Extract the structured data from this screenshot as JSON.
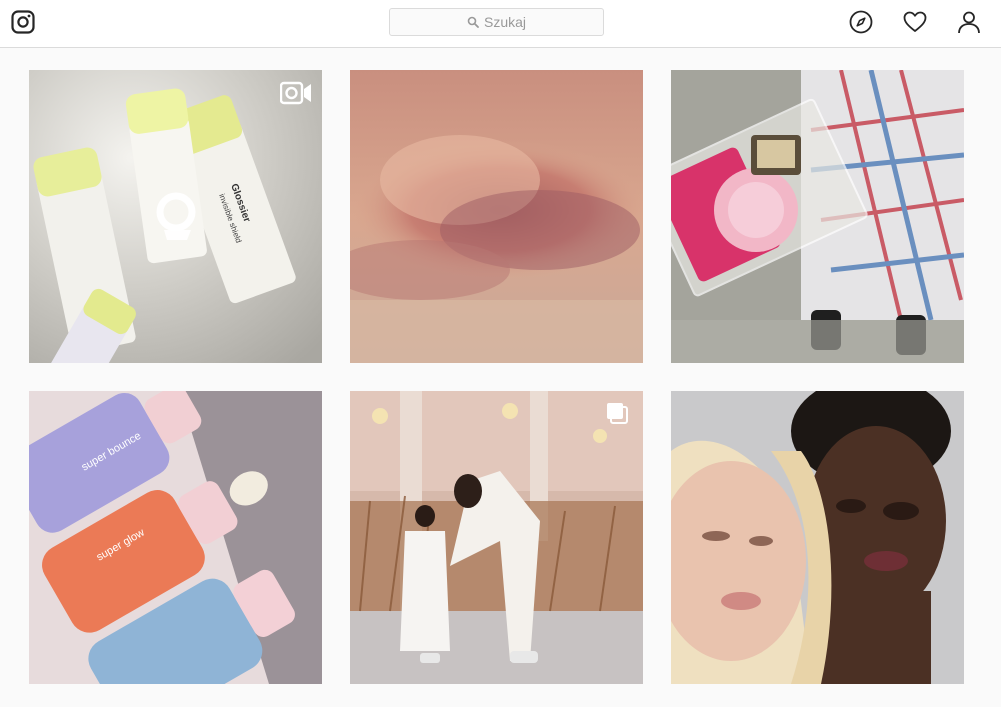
{
  "header": {
    "logo_icon": "instagram-camera-icon",
    "search": {
      "placeholder": "Szukaj",
      "icon": "search-icon"
    },
    "nav": [
      {
        "name": "explore",
        "icon": "compass-icon"
      },
      {
        "name": "activity",
        "icon": "heart-icon"
      },
      {
        "name": "profile",
        "icon": "user-icon"
      }
    ]
  },
  "grid": {
    "posts": [
      {
        "id": "post-1",
        "subject": "Glossier skincare bottles",
        "badge": "video-icon",
        "printed_text": [
          "Glossier",
          "invisible shield"
        ]
      },
      {
        "id": "post-2",
        "subject": "Pink sunset clouds",
        "badge": ""
      },
      {
        "id": "post-3",
        "subject": "Clear bag with pink compact",
        "badge": ""
      },
      {
        "id": "post-4",
        "subject": "Glossier serums",
        "badge": "",
        "printed_text": [
          "super bounce",
          "super glow"
        ]
      },
      {
        "id": "post-5",
        "subject": "Woman and child in showroom",
        "badge": "multiple-photos-icon"
      },
      {
        "id": "post-6",
        "subject": "Two women portrait",
        "badge": ""
      }
    ]
  },
  "colors": {
    "header_bg": "#ffffff",
    "page_bg": "#fafafa",
    "border": "#dbdbdb",
    "icon": "#262626",
    "placeholder": "#999999"
  }
}
